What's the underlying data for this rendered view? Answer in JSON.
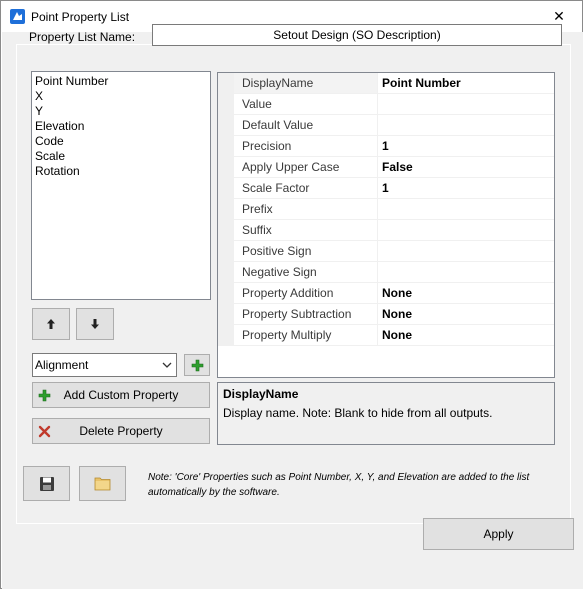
{
  "window": {
    "title": "Point Property List",
    "close_glyph": "✕"
  },
  "list_name": {
    "label": "Property List Name:",
    "value": "Setout Design (SO Description)"
  },
  "properties": {
    "items": [
      "Point Number",
      "X",
      "Y",
      "Elevation",
      "Code",
      "Scale",
      "Rotation"
    ]
  },
  "move_buttons": {
    "up_icon": "arrow-up-icon",
    "down_icon": "arrow-down-icon"
  },
  "custom": {
    "dropdown_value": "Alignment",
    "add_label": "Add Custom Property",
    "delete_label": "Delete Property"
  },
  "grid": {
    "rows": [
      {
        "name": "DisplayName",
        "value": "Point Number"
      },
      {
        "name": "Value",
        "value": ""
      },
      {
        "name": "Default Value",
        "value": ""
      },
      {
        "name": "Precision",
        "value": "1"
      },
      {
        "name": "Apply Upper Case",
        "value": "False"
      },
      {
        "name": "Scale Factor",
        "value": "1"
      },
      {
        "name": "Prefix",
        "value": ""
      },
      {
        "name": "Suffix",
        "value": ""
      },
      {
        "name": "Positive Sign",
        "value": ""
      },
      {
        "name": "Negative Sign",
        "value": ""
      },
      {
        "name": "Property Addition",
        "value": "None"
      },
      {
        "name": "Property Subtraction",
        "value": "None"
      },
      {
        "name": "Property Multiply",
        "value": "None"
      }
    ]
  },
  "help": {
    "title": "DisplayName",
    "description": "Display name. Note: Blank to hide from all outputs."
  },
  "footer": {
    "note": "Note: 'Core' Properties such as Point Number, X, Y, and Elevation are added to the list automatically by the software.",
    "apply_label": "Apply"
  },
  "colors": {
    "plus_green": "#2e9e2e",
    "delete_red": "#c0392b",
    "folder_yellow": "#e8c26a",
    "save_dark": "#3c3c3c"
  }
}
